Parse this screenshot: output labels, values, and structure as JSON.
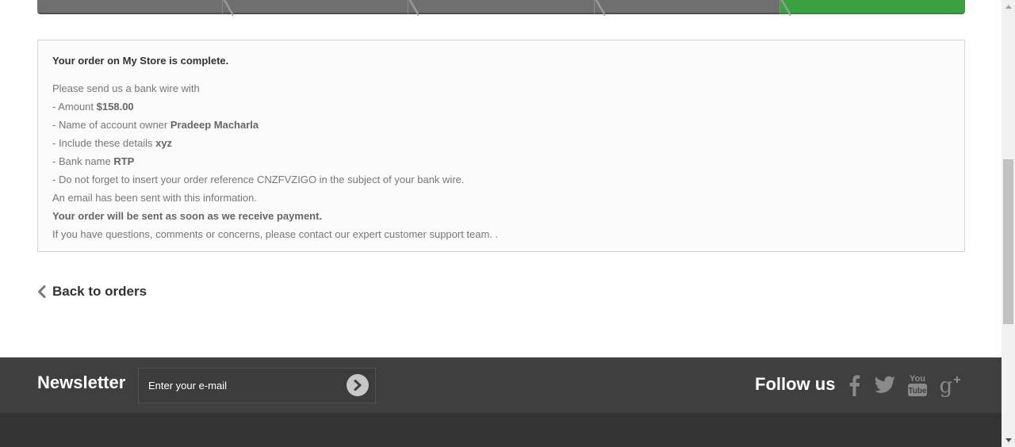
{
  "order_box": {
    "headline_prefix": "Your order on",
    "store_name": "My Store",
    "headline_suffix": "is complete.",
    "intro": "Please send us a bank wire with",
    "amount_label": "- Amount",
    "amount_value": "$158.00",
    "owner_label": "- Name of account owner",
    "owner_value": "Pradeep Macharla",
    "details_label": "- Include these details",
    "details_value": "xyz",
    "bank_label": "- Bank name",
    "bank_value": "RTP",
    "reference_line": "- Do not forget to insert your order reference CNZFVZIGO in the subject of your bank wire.",
    "email_line": "An email has been sent with this information.",
    "shipping_line": "Your order will be sent as soon as we receive payment.",
    "support_line": "If you have questions, comments or concerns, please contact our expert customer support team. ."
  },
  "back_link": {
    "label": "Back to orders",
    "icon": "chevron-left-icon"
  },
  "newsletter": {
    "title": "Newsletter",
    "placeholder": "Enter your e-mail",
    "submit_icon": "chevron-right-circle-icon"
  },
  "follow": {
    "title": "Follow us",
    "icons": [
      "facebook-icon",
      "twitter-icon",
      "youtube-icon",
      "google-plus-icon"
    ]
  },
  "colors": {
    "current_step": "#3aa140",
    "step": "#6f6f6f",
    "footer_top": "#3f3f3f",
    "footer_bottom": "#333333"
  }
}
